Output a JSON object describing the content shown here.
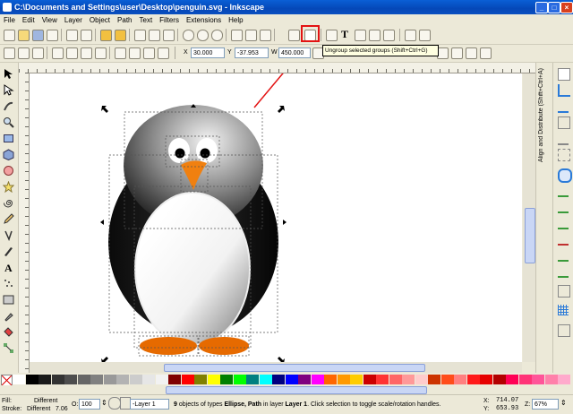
{
  "window": {
    "title": "C:\\Documents and Settings\\user\\Desktop\\penguin.svg - Inkscape"
  },
  "menu": [
    "File",
    "Edit",
    "View",
    "Layer",
    "Object",
    "Path",
    "Text",
    "Filters",
    "Extensions",
    "Help"
  ],
  "tooltip": "Ungroup selected groups (Shift+Ctrl+G)",
  "toolbar2": {
    "x_label": "X",
    "x_value": "30.000",
    "y_label": "Y",
    "y_value": "-37.953",
    "w_label": "W",
    "w_value": "450.000"
  },
  "dock": {
    "panel_title": "Align and Distribute (Shift+Ctrl+A)"
  },
  "status": {
    "fill_label": "Fill:",
    "fill_value": "Different",
    "stroke_label": "Stroke:",
    "stroke_value": "Different",
    "stroke_width": "7.06",
    "opacity_label": "O:",
    "opacity_value": "100",
    "layer_value": "-Layer 1",
    "message_count": "9",
    "message_pre": " objects of types ",
    "message_types": "Ellipse, Path",
    "message_mid": " in layer ",
    "message_layer": "Layer 1",
    "message_post": ". Click selection to toggle scale/rotation handles.",
    "x_label": "X:",
    "x_value": "714.07",
    "y_label": "Y:",
    "y_value": "653.93",
    "zoom_label": "Z:",
    "zoom_value": "67%"
  },
  "colors": {
    "title_blue": "#0548b8",
    "highlight_red": "#e31313",
    "penguin_beak": "#f08010",
    "penguin_feet": "#e66a00"
  },
  "palette_colors": [
    "#ffffff",
    "#000000",
    "#1a1a1a",
    "#333333",
    "#4d4d4d",
    "#666666",
    "#808080",
    "#999999",
    "#b3b3b3",
    "#cccccc",
    "#e6e6e6",
    "#f2f2f2",
    "#800000",
    "#ff0000",
    "#808000",
    "#ffff00",
    "#008000",
    "#00ff00",
    "#008080",
    "#00ffff",
    "#000080",
    "#0000ff",
    "#800080",
    "#ff00ff",
    "#ff6600",
    "#ff9900",
    "#ffcc00",
    "#cc0000",
    "#ff3333",
    "#ff6666",
    "#ff9999",
    "#ffcccc",
    "#cc3300",
    "#ff4d1a",
    "#ff8080",
    "#ff1a1a",
    "#e60000",
    "#b30000",
    "#ff0055",
    "#ff3377",
    "#ff5599",
    "#ff80aa",
    "#ffaacc"
  ]
}
